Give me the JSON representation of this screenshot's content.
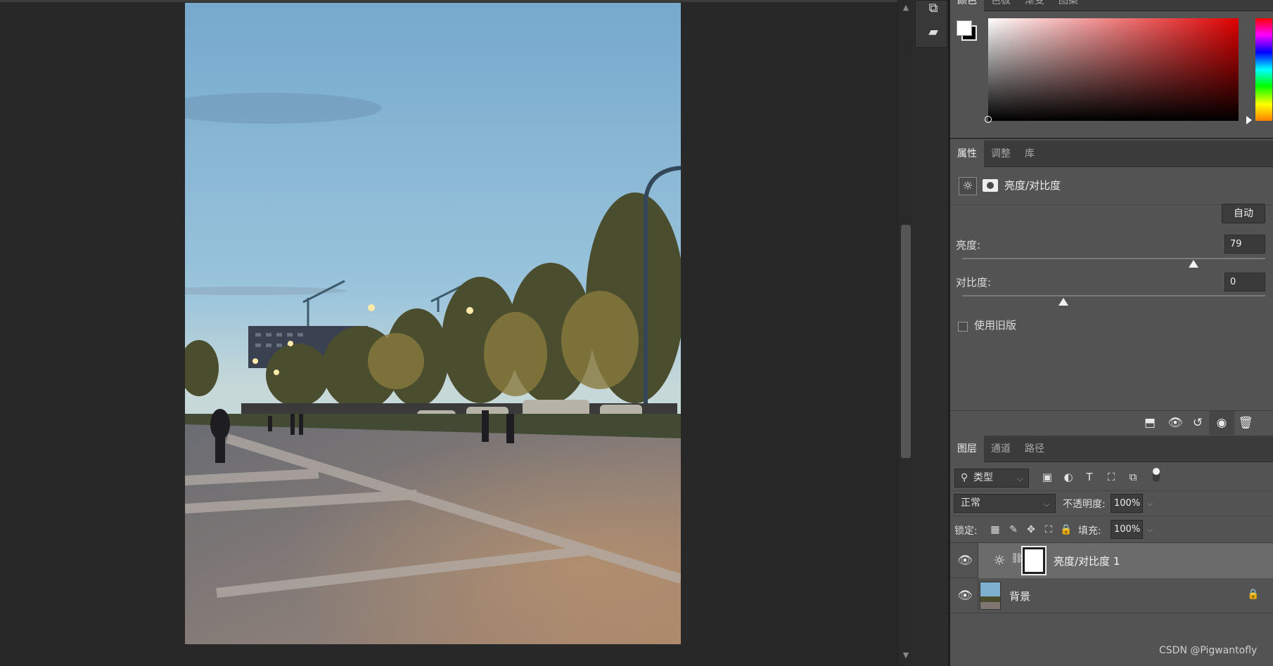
{
  "color_panel": {
    "tabs": [
      {
        "label": "颜色"
      },
      {
        "label": "色板"
      },
      {
        "label": "渐变"
      },
      {
        "label": "图案"
      }
    ]
  },
  "properties": {
    "tabs": [
      {
        "label": "属性"
      },
      {
        "label": "调整"
      },
      {
        "label": "库"
      }
    ],
    "title": "亮度/对比度",
    "auto_label": "自动",
    "brightness_label": "亮度:",
    "brightness_value": "79",
    "brightness_range": [
      -150,
      150
    ],
    "contrast_label": "对比度:",
    "contrast_value": "0",
    "contrast_range": [
      -50,
      100
    ],
    "legacy_label": "使用旧版",
    "legacy_checked": false
  },
  "layers": {
    "tabs": [
      {
        "label": "图层"
      },
      {
        "label": "通道"
      },
      {
        "label": "路径"
      }
    ],
    "filter_label": "类型",
    "blend_mode": "正常",
    "opacity_label": "不透明度:",
    "opacity_value": "100%",
    "lock_label": "锁定:",
    "fill_label": "填充:",
    "fill_value": "100%",
    "items": [
      {
        "name": "亮度/对比度 1",
        "visible": true,
        "selected": true
      },
      {
        "name": "背景",
        "visible": true,
        "locked": true
      }
    ]
  },
  "colors": {
    "foreground": "#ffffff",
    "background": "#000000",
    "panel_bg": "#535353",
    "canvas_bg": "#282828"
  },
  "watermark": "CSDN @Pigwantofly"
}
